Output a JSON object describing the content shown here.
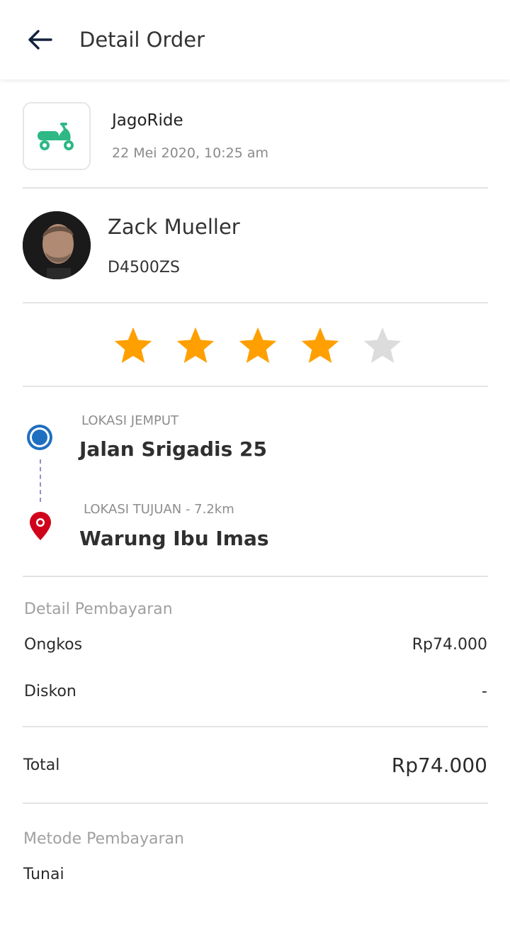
{
  "header": {
    "title": "Detail Order",
    "back_icon": "arrow-left-icon"
  },
  "service": {
    "name": "JagoRide",
    "datetime": "22 Mei 2020, 10:25 am",
    "icon": "scooter-icon",
    "icon_color": "#2db886"
  },
  "driver": {
    "name": "Zack Mueller",
    "plate": "D4500ZS"
  },
  "rating": {
    "value": 4,
    "max": 5,
    "filled_color": "#ff9f00",
    "empty_color": "#dcdcdc"
  },
  "route": {
    "pickup_label": "LOKASI JEMPUT",
    "pickup_name": "Jalan Srigadis 25",
    "dest_label": "LOKASI TUJUAN - 7.2km",
    "dest_name": "Warung Ibu Imas",
    "pickup_color": "#1e6fc0",
    "dest_color": "#d0021b"
  },
  "payment": {
    "section_title": "Detail Pembayaran",
    "fare_label": "Ongkos",
    "fare_value": "Rp74.000",
    "discount_label": "Diskon",
    "discount_value": "-",
    "total_label": "Total",
    "total_value": "Rp74.000"
  },
  "method": {
    "section_title": "Metode Pembayaran",
    "value": "Tunai"
  }
}
